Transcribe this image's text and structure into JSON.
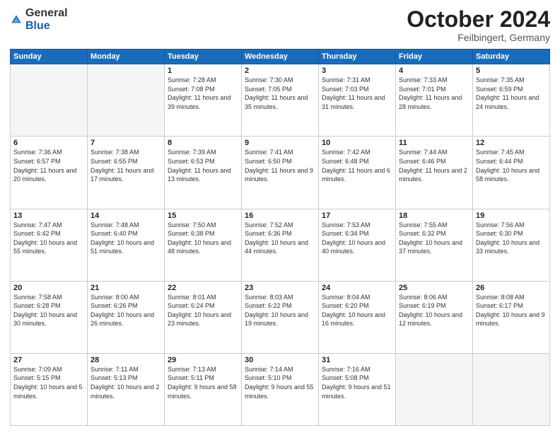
{
  "header": {
    "logo_general": "General",
    "logo_blue": "Blue",
    "month_title": "October 2024",
    "location": "Feilbingert, Germany"
  },
  "days_of_week": [
    "Sunday",
    "Monday",
    "Tuesday",
    "Wednesday",
    "Thursday",
    "Friday",
    "Saturday"
  ],
  "weeks": [
    [
      {
        "day": "",
        "content": ""
      },
      {
        "day": "",
        "content": ""
      },
      {
        "day": "1",
        "content": "Sunrise: 7:28 AM\nSunset: 7:08 PM\nDaylight: 11 hours and 39 minutes."
      },
      {
        "day": "2",
        "content": "Sunrise: 7:30 AM\nSunset: 7:05 PM\nDaylight: 11 hours and 35 minutes."
      },
      {
        "day": "3",
        "content": "Sunrise: 7:31 AM\nSunset: 7:03 PM\nDaylight: 11 hours and 31 minutes."
      },
      {
        "day": "4",
        "content": "Sunrise: 7:33 AM\nSunset: 7:01 PM\nDaylight: 11 hours and 28 minutes."
      },
      {
        "day": "5",
        "content": "Sunrise: 7:35 AM\nSunset: 6:59 PM\nDaylight: 11 hours and 24 minutes."
      }
    ],
    [
      {
        "day": "6",
        "content": "Sunrise: 7:36 AM\nSunset: 6:57 PM\nDaylight: 11 hours and 20 minutes."
      },
      {
        "day": "7",
        "content": "Sunrise: 7:38 AM\nSunset: 6:55 PM\nDaylight: 11 hours and 17 minutes."
      },
      {
        "day": "8",
        "content": "Sunrise: 7:39 AM\nSunset: 6:53 PM\nDaylight: 11 hours and 13 minutes."
      },
      {
        "day": "9",
        "content": "Sunrise: 7:41 AM\nSunset: 6:50 PM\nDaylight: 11 hours and 9 minutes."
      },
      {
        "day": "10",
        "content": "Sunrise: 7:42 AM\nSunset: 6:48 PM\nDaylight: 11 hours and 6 minutes."
      },
      {
        "day": "11",
        "content": "Sunrise: 7:44 AM\nSunset: 6:46 PM\nDaylight: 11 hours and 2 minutes."
      },
      {
        "day": "12",
        "content": "Sunrise: 7:45 AM\nSunset: 6:44 PM\nDaylight: 10 hours and 58 minutes."
      }
    ],
    [
      {
        "day": "13",
        "content": "Sunrise: 7:47 AM\nSunset: 6:42 PM\nDaylight: 10 hours and 55 minutes."
      },
      {
        "day": "14",
        "content": "Sunrise: 7:48 AM\nSunset: 6:40 PM\nDaylight: 10 hours and 51 minutes."
      },
      {
        "day": "15",
        "content": "Sunrise: 7:50 AM\nSunset: 6:38 PM\nDaylight: 10 hours and 48 minutes."
      },
      {
        "day": "16",
        "content": "Sunrise: 7:52 AM\nSunset: 6:36 PM\nDaylight: 10 hours and 44 minutes."
      },
      {
        "day": "17",
        "content": "Sunrise: 7:53 AM\nSunset: 6:34 PM\nDaylight: 10 hours and 40 minutes."
      },
      {
        "day": "18",
        "content": "Sunrise: 7:55 AM\nSunset: 6:32 PM\nDaylight: 10 hours and 37 minutes."
      },
      {
        "day": "19",
        "content": "Sunrise: 7:56 AM\nSunset: 6:30 PM\nDaylight: 10 hours and 33 minutes."
      }
    ],
    [
      {
        "day": "20",
        "content": "Sunrise: 7:58 AM\nSunset: 6:28 PM\nDaylight: 10 hours and 30 minutes."
      },
      {
        "day": "21",
        "content": "Sunrise: 8:00 AM\nSunset: 6:26 PM\nDaylight: 10 hours and 26 minutes."
      },
      {
        "day": "22",
        "content": "Sunrise: 8:01 AM\nSunset: 6:24 PM\nDaylight: 10 hours and 23 minutes."
      },
      {
        "day": "23",
        "content": "Sunrise: 8:03 AM\nSunset: 6:22 PM\nDaylight: 10 hours and 19 minutes."
      },
      {
        "day": "24",
        "content": "Sunrise: 8:04 AM\nSunset: 6:20 PM\nDaylight: 10 hours and 16 minutes."
      },
      {
        "day": "25",
        "content": "Sunrise: 8:06 AM\nSunset: 6:19 PM\nDaylight: 10 hours and 12 minutes."
      },
      {
        "day": "26",
        "content": "Sunrise: 8:08 AM\nSunset: 6:17 PM\nDaylight: 10 hours and 9 minutes."
      }
    ],
    [
      {
        "day": "27",
        "content": "Sunrise: 7:09 AM\nSunset: 5:15 PM\nDaylight: 10 hours and 5 minutes."
      },
      {
        "day": "28",
        "content": "Sunrise: 7:11 AM\nSunset: 5:13 PM\nDaylight: 10 hours and 2 minutes."
      },
      {
        "day": "29",
        "content": "Sunrise: 7:13 AM\nSunset: 5:11 PM\nDaylight: 9 hours and 58 minutes."
      },
      {
        "day": "30",
        "content": "Sunrise: 7:14 AM\nSunset: 5:10 PM\nDaylight: 9 hours and 55 minutes."
      },
      {
        "day": "31",
        "content": "Sunrise: 7:16 AM\nSunset: 5:08 PM\nDaylight: 9 hours and 51 minutes."
      },
      {
        "day": "",
        "content": ""
      },
      {
        "day": "",
        "content": ""
      }
    ]
  ]
}
